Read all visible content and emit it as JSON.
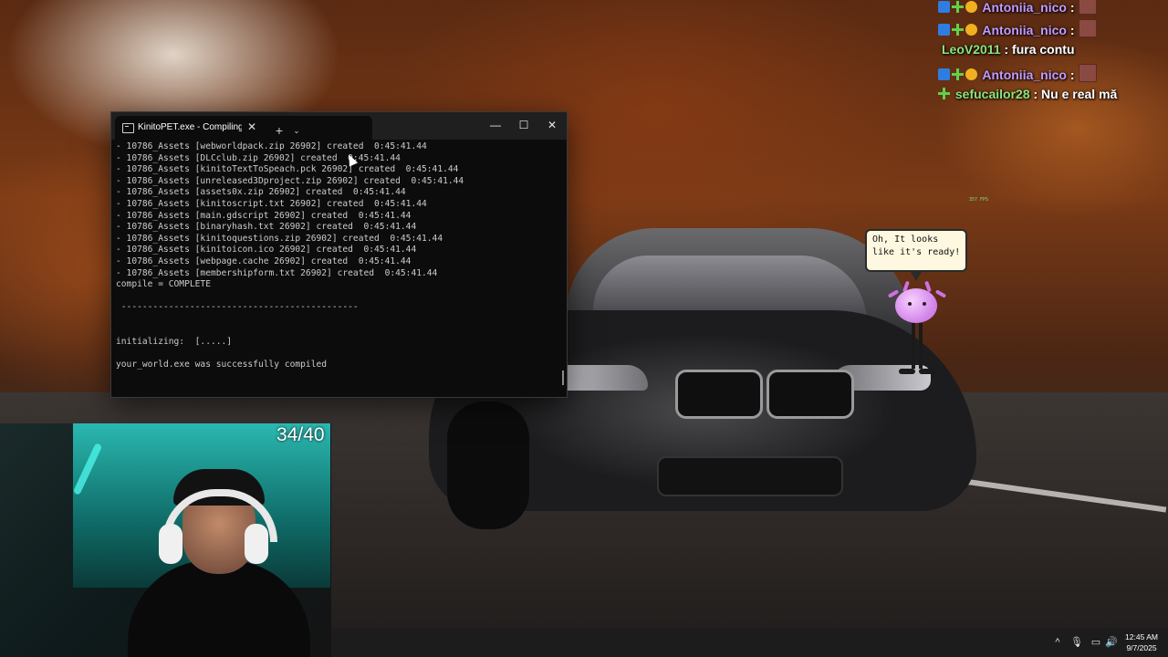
{
  "terminal": {
    "tab_title": "KinitoPET.exe - Compiling (Ac",
    "tab_close": "✕",
    "new_tab": "+",
    "dropdown": "⌄",
    "minimize": "—",
    "maximize": "☐",
    "close": "✕",
    "lines": [
      "- 10786_Assets [webworldpack.zip 26902] created  0:45:41.44",
      "- 10786_Assets [DLCclub.zip 26902] created  0:45:41.44",
      "- 10786_Assets [kinitoTextToSpeach.pck 26902] created  0:45:41.44",
      "- 10786_Assets [unreleased3Dproject.zip 26902] created  0:45:41.44",
      "- 10786_Assets [assets0x.zip 26902] created  0:45:41.44",
      "- 10786_Assets [kinitoscript.txt 26902] created  0:45:41.44",
      "- 10786_Assets [main.gdscript 26902] created  0:45:41.44",
      "- 10786_Assets [binaryhash.txt 26902] created  0:45:41.44",
      "- 10786_Assets [kinitoquestions.zip 26902] created  0:45:41.44",
      "- 10786_Assets [kinitoicon.ico 26902] created  0:45:41.44",
      "- 10786_Assets [webpage.cache 26902] created  0:45:41.44",
      "- 10786_Assets [membershipform.txt 26902] created  0:45:41.44",
      "compile = COMPLETE",
      "",
      " ---------------------------------------------",
      "",
      "",
      "initializing:  [.....]",
      "",
      "your_world.exe was successfully compiled"
    ]
  },
  "chat": [
    {
      "user": "Antoniia_nico",
      "sep": " :",
      "text": "",
      "badges": true,
      "emote": true,
      "style": "purple"
    },
    {
      "user": "Antoniia_nico",
      "sep": " :",
      "text": "",
      "badges": true,
      "emote": true,
      "style": "purple"
    },
    {
      "user": "LeoV2011",
      "sep": " :",
      "text": " fura contu",
      "badges": false,
      "emote": false,
      "style": "white"
    },
    {
      "user": "Antoniia_nico",
      "sep": " :",
      "text": "",
      "badges": true,
      "emote": true,
      "style": "purple"
    },
    {
      "user": "sefucailor28",
      "sep": " :",
      "text": " Nu e real mă",
      "badges": "green",
      "emote": false,
      "style": "green"
    }
  ],
  "fps": "357 FPS",
  "pet": {
    "speech": "Oh, It looks\nlike it's ready!"
  },
  "webcam": {
    "counter": "34/40"
  },
  "taskbar": {
    "tray_chevron": "^",
    "mic": "🎙",
    "display": "▭",
    "volume": "🔊",
    "time": "12:45 AM",
    "date": "9/7/2025"
  }
}
